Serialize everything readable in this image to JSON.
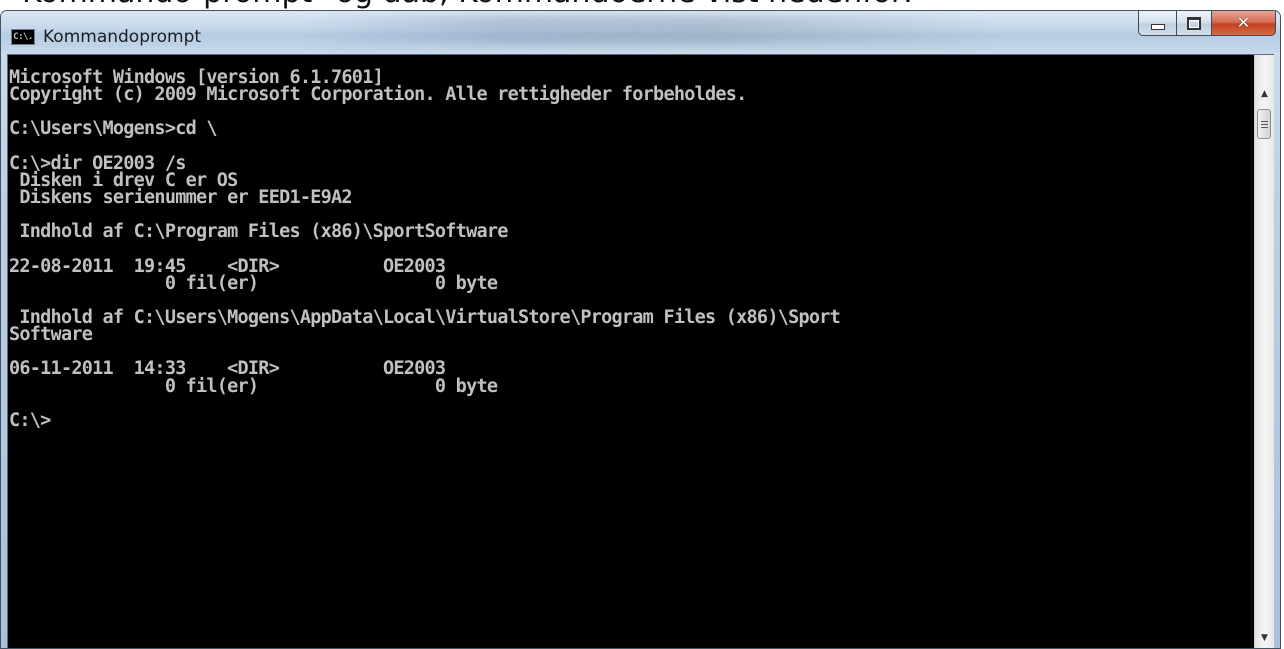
{
  "page_caption": "Kommando-prompt\" og dab, Kommandoerne vist nedenfor:",
  "window": {
    "title": "Kommandoprompt",
    "icon_text": "C:\\.",
    "icon_name": "console-icon"
  },
  "console": {
    "lines": [
      "Microsoft Windows [version 6.1.7601]",
      "Copyright (c) 2009 Microsoft Corporation. Alle rettigheder forbeholdes.",
      "",
      "C:\\Users\\Mogens>cd \\",
      "",
      "C:\\>dir OE2003 /s",
      " Disken i drev C er OS",
      " Diskens serienummer er EED1-E9A2",
      "",
      " Indhold af C:\\Program Files (x86)\\SportSoftware",
      "",
      "22-08-2011  19:45    <DIR>          OE2003",
      "               0 fil(er)                 0 byte",
      "",
      " Indhold af C:\\Users\\Mogens\\AppData\\Local\\VirtualStore\\Program Files (x86)\\Sport",
      "Software",
      "",
      "06-11-2011  14:33    <DIR>          OE2003",
      "               0 fil(er)                 0 byte",
      "",
      "C:\\>"
    ]
  },
  "colors": {
    "console_background": "#000000",
    "console_text": "#c0c0c0",
    "close_button": "#c44224"
  },
  "icons": {
    "minimize": "minimize-icon",
    "maximize": "maximize-icon",
    "close": "close-icon",
    "scroll_up": "chevron-up-icon",
    "scroll_down": "chevron-down-icon"
  }
}
